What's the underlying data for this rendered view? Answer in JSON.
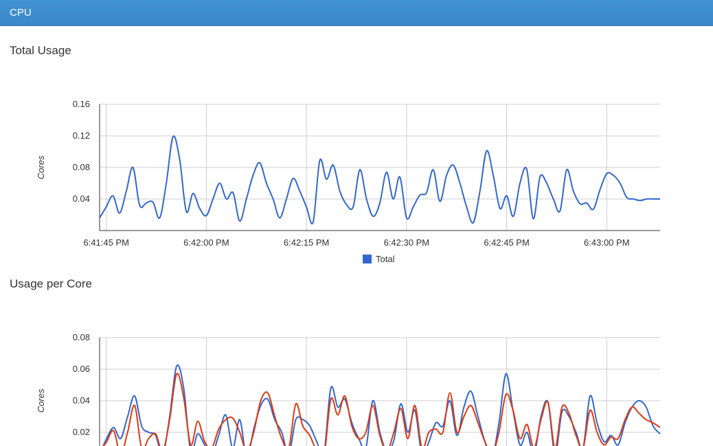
{
  "panel": {
    "title": "CPU"
  },
  "sections": {
    "total_title": "Total Usage",
    "core_title": "Usage per Core"
  },
  "colors": {
    "header": "#3a86c8",
    "series_blue": "#3366cc",
    "series_red": "#dc3912",
    "grid": "#cccccc"
  },
  "chart_data": [
    {
      "type": "line",
      "title": "Total Usage",
      "ylabel": "Cores",
      "ylim": [
        0,
        0.16
      ],
      "yticks": [
        0.04,
        0.08,
        0.12,
        0.16
      ],
      "xlim": [
        "6:41:44 PM",
        "6:43:08 PM"
      ],
      "xticks": [
        "6:41:45 PM",
        "6:42:00 PM",
        "6:42:15 PM",
        "6:42:30 PM",
        "6:42:45 PM",
        "6:43:00 PM"
      ],
      "legend": "bottom",
      "series": [
        {
          "name": "Total",
          "color": "#3366cc",
          "x": [
            0,
            1,
            2,
            3,
            4,
            5,
            6,
            7,
            8,
            9,
            10,
            11,
            12,
            13,
            14,
            15,
            16,
            17,
            18,
            19,
            20,
            21,
            22,
            23,
            24,
            25,
            26,
            27,
            28,
            29,
            30,
            31,
            32,
            33,
            34,
            35,
            36,
            37,
            38,
            39,
            40,
            41,
            42,
            43,
            44,
            45,
            46,
            47,
            48,
            49,
            50,
            51,
            52,
            53,
            54,
            55,
            56,
            57,
            58,
            59,
            60,
            61,
            62,
            63,
            64,
            65,
            66,
            67,
            68,
            69,
            70,
            71,
            72,
            73,
            74,
            75,
            76,
            77,
            78,
            79,
            80,
            81,
            82,
            83,
            84
          ],
          "values": [
            0.016,
            0.03,
            0.044,
            0.022,
            0.05,
            0.08,
            0.032,
            0.035,
            0.036,
            0.016,
            0.06,
            0.119,
            0.09,
            0.024,
            0.047,
            0.028,
            0.019,
            0.04,
            0.06,
            0.04,
            0.048,
            0.012,
            0.04,
            0.07,
            0.086,
            0.06,
            0.04,
            0.016,
            0.04,
            0.066,
            0.05,
            0.03,
            0.011,
            0.089,
            0.065,
            0.083,
            0.05,
            0.033,
            0.03,
            0.077,
            0.04,
            0.018,
            0.035,
            0.074,
            0.04,
            0.068,
            0.016,
            0.03,
            0.045,
            0.048,
            0.077,
            0.037,
            0.07,
            0.083,
            0.06,
            0.03,
            0.01,
            0.05,
            0.101,
            0.07,
            0.028,
            0.044,
            0.018,
            0.06,
            0.078,
            0.015,
            0.068,
            0.06,
            0.04,
            0.025,
            0.077,
            0.05,
            0.034,
            0.035,
            0.027,
            0.052,
            0.072,
            0.07,
            0.06,
            0.042,
            0.04,
            0.038,
            0.04,
            0.04,
            0.04
          ]
        }
      ]
    },
    {
      "type": "line",
      "title": "Usage per Core",
      "ylabel": "Cores",
      "ylim": [
        0,
        0.08
      ],
      "yticks": [
        0.02,
        0.04,
        0.06,
        0.08
      ],
      "series": [
        {
          "color": "#3366cc",
          "x": [
            0,
            1,
            2,
            3,
            4,
            5,
            6,
            7,
            8,
            9,
            10,
            11,
            12,
            13,
            14,
            15,
            16,
            17,
            18,
            19,
            20,
            21,
            22,
            23,
            24,
            25,
            26,
            27,
            28,
            29,
            30,
            31,
            32,
            33,
            34,
            35,
            36,
            37,
            38,
            39,
            40,
            41,
            42,
            43,
            44,
            45,
            46,
            47,
            48,
            49,
            50,
            51,
            52,
            53,
            54,
            55,
            56,
            57,
            58,
            59,
            60,
            61,
            62,
            63,
            64,
            65,
            66,
            67,
            68,
            69,
            70,
            71,
            72,
            73,
            74,
            75,
            76,
            77,
            78,
            79,
            80
          ],
          "values": [
            0.006,
            0.016,
            0.023,
            0.016,
            0.03,
            0.043,
            0.024,
            0.02,
            0.018,
            0.006,
            0.03,
            0.062,
            0.048,
            0.008,
            0.019,
            0.012,
            0.006,
            0.018,
            0.031,
            0.01,
            0.028,
            0.004,
            0.022,
            0.037,
            0.041,
            0.028,
            0.02,
            0.006,
            0.028,
            0.028,
            0.024,
            0.014,
            0.006,
            0.048,
            0.036,
            0.041,
            0.026,
            0.016,
            0.01,
            0.04,
            0.02,
            0.008,
            0.015,
            0.038,
            0.02,
            0.034,
            0.006,
            0.014,
            0.026,
            0.024,
            0.04,
            0.018,
            0.036,
            0.046,
            0.03,
            0.014,
            0.004,
            0.026,
            0.057,
            0.034,
            0.012,
            0.02,
            0.006,
            0.03,
            0.039,
            0.006,
            0.033,
            0.03,
            0.02,
            0.01,
            0.043,
            0.026,
            0.014,
            0.018,
            0.012,
            0.026,
            0.036,
            0.04,
            0.036,
            0.024,
            0.019
          ]
        },
        {
          "color": "#dc3912",
          "x": [
            0,
            1,
            2,
            3,
            4,
            5,
            6,
            7,
            8,
            9,
            10,
            11,
            12,
            13,
            14,
            15,
            16,
            17,
            18,
            19,
            20,
            21,
            22,
            23,
            24,
            25,
            26,
            27,
            28,
            29,
            30,
            31,
            32,
            33,
            34,
            35,
            36,
            37,
            38,
            39,
            40,
            41,
            42,
            43,
            44,
            45,
            46,
            47,
            48,
            49,
            50,
            51,
            52,
            53,
            54,
            55,
            56,
            57,
            58,
            59,
            60,
            61,
            62,
            63,
            64,
            65,
            66,
            67,
            68,
            69,
            70,
            71,
            72,
            73,
            74,
            75,
            76,
            77,
            78,
            79,
            80
          ],
          "values": [
            0.008,
            0.014,
            0.021,
            0.006,
            0.02,
            0.037,
            0.01,
            0.016,
            0.019,
            0.008,
            0.028,
            0.057,
            0.042,
            0.012,
            0.027,
            0.014,
            0.01,
            0.022,
            0.028,
            0.029,
            0.02,
            0.008,
            0.02,
            0.04,
            0.045,
            0.03,
            0.016,
            0.01,
            0.038,
            0.024,
            0.018,
            0.008,
            0.004,
            0.041,
            0.031,
            0.043,
            0.024,
            0.016,
            0.02,
            0.037,
            0.018,
            0.008,
            0.02,
            0.035,
            0.016,
            0.037,
            0.01,
            0.02,
            0.022,
            0.02,
            0.045,
            0.02,
            0.03,
            0.037,
            0.026,
            0.014,
            0.006,
            0.02,
            0.044,
            0.034,
            0.016,
            0.025,
            0.01,
            0.028,
            0.039,
            0.01,
            0.036,
            0.032,
            0.018,
            0.01,
            0.034,
            0.02,
            0.012,
            0.017,
            0.016,
            0.028,
            0.036,
            0.032,
            0.028,
            0.026,
            0.023
          ]
        }
      ]
    }
  ]
}
